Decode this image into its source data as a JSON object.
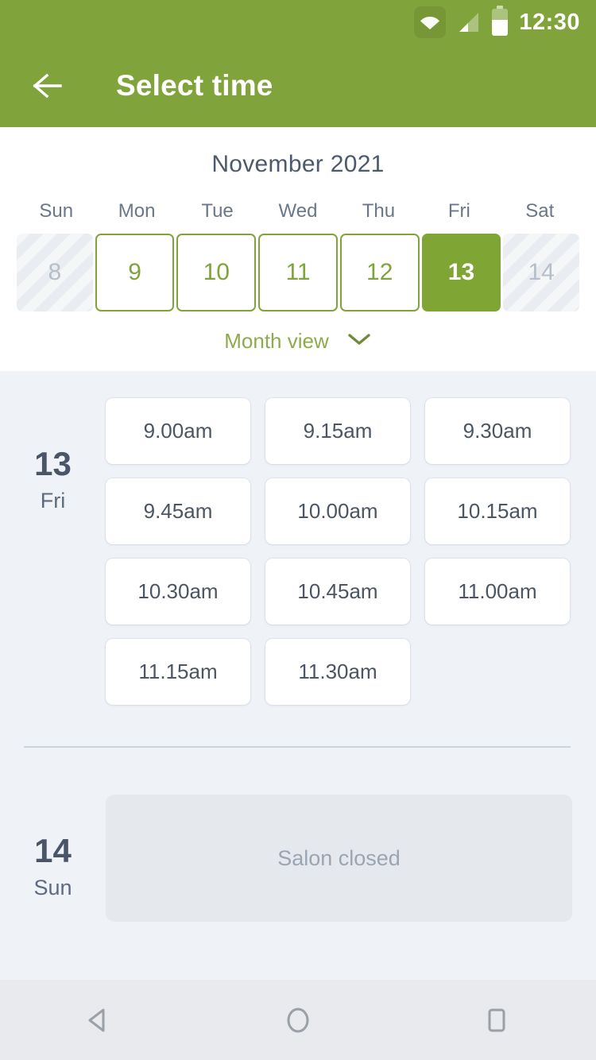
{
  "status_bar": {
    "time": "12:30",
    "icons": [
      "wifi-icon",
      "signal-icon",
      "battery-icon"
    ]
  },
  "app_bar": {
    "title": "Select time",
    "back_icon": "arrow-left-icon"
  },
  "calendar": {
    "month_title": "November 2021",
    "weekdays": [
      "Sun",
      "Mon",
      "Tue",
      "Wed",
      "Thu",
      "Fri",
      "Sat"
    ],
    "days": [
      {
        "number": "8",
        "state": "disabled"
      },
      {
        "number": "9",
        "state": "available"
      },
      {
        "number": "10",
        "state": "available"
      },
      {
        "number": "11",
        "state": "available"
      },
      {
        "number": "12",
        "state": "available"
      },
      {
        "number": "13",
        "state": "selected"
      },
      {
        "number": "14",
        "state": "disabled"
      }
    ],
    "month_view_label": "Month view",
    "month_view_icon": "chevron-down-icon"
  },
  "schedule": [
    {
      "day_number": "13",
      "weekday": "Fri",
      "slots": [
        "9.00am",
        "9.15am",
        "9.30am",
        "9.45am",
        "10.00am",
        "10.15am",
        "10.30am",
        "10.45am",
        "11.00am",
        "11.15am",
        "11.30am"
      ]
    },
    {
      "day_number": "14",
      "weekday": "Sun",
      "closed_label": "Salon closed"
    }
  ],
  "nav_bar": {
    "back": "nav-back-icon",
    "home": "nav-home-icon",
    "recents": "nav-recents-icon"
  },
  "colors": {
    "brand_green": "#80a33c",
    "selected_green": "#7fa635",
    "body_bg": "#eff2f7",
    "slate_text": "#4a5568"
  }
}
